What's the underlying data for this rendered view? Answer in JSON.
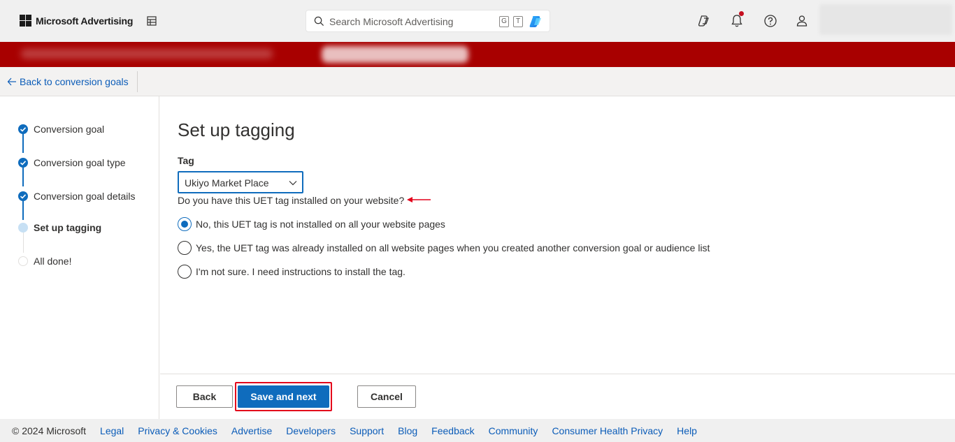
{
  "header": {
    "app_name": "Microsoft Advertising",
    "search_placeholder": "Search Microsoft Advertising",
    "shortcut_keys": [
      "G",
      "T"
    ]
  },
  "backbar": {
    "back_label": "Back to conversion goals"
  },
  "stepper": {
    "steps": [
      {
        "label": "Conversion goal",
        "state": "done"
      },
      {
        "label": "Conversion goal type",
        "state": "done"
      },
      {
        "label": "Conversion goal details",
        "state": "done"
      },
      {
        "label": "Set up tagging",
        "state": "current"
      },
      {
        "label": "All done!",
        "state": "todo"
      }
    ]
  },
  "main": {
    "title": "Set up tagging",
    "tag_label": "Tag",
    "tag_selected": "Ukiyo Market Place",
    "question": "Do you have this UET tag installed on your website?",
    "options": [
      {
        "label": "No, this UET tag is not installed on all your website pages",
        "checked": true
      },
      {
        "label": "Yes, the UET tag was already installed on all website pages when you created another conversion goal or audience list",
        "checked": false
      },
      {
        "label": "I'm not sure. I need instructions to install the tag.",
        "checked": false
      }
    ]
  },
  "actions": {
    "back_label": "Back",
    "save_label": "Save and next",
    "cancel_label": "Cancel"
  },
  "footer": {
    "copyright": "© 2024 Microsoft",
    "links": [
      "Legal",
      "Privacy & Cookies",
      "Advertise",
      "Developers",
      "Support",
      "Blog",
      "Feedback",
      "Community",
      "Consumer Health Privacy",
      "Help"
    ]
  },
  "colors": {
    "accent": "#0f6cbd",
    "banner": "#a80000",
    "highlight": "#e3001b"
  }
}
